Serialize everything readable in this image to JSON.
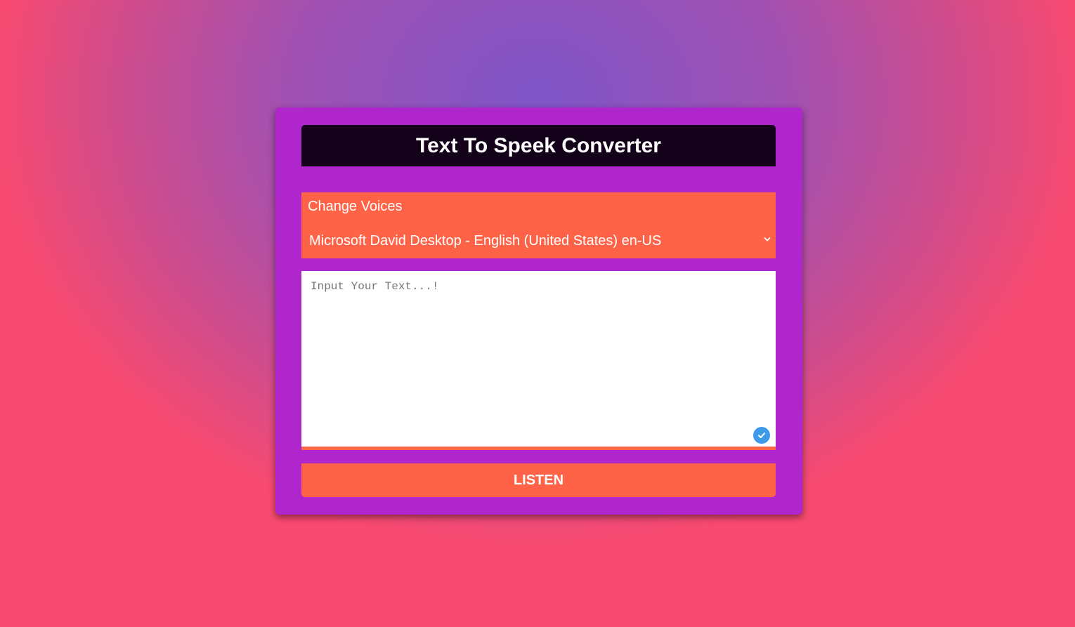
{
  "header": {
    "title": "Text To Speek Converter"
  },
  "voice": {
    "label": "Change Voices",
    "selected": "Microsoft David Desktop - English (United States) en-US",
    "dropdown_icon": "chevron-down-icon"
  },
  "text_input": {
    "placeholder": "Input Your Text...!",
    "value": "",
    "badge_icon": "check-circle-icon"
  },
  "listen_button": {
    "label": "LISTEN"
  },
  "colors": {
    "card": "#b026cd",
    "header": "#13021a",
    "accent": "#ff6347",
    "badge": "#3d9be9"
  }
}
